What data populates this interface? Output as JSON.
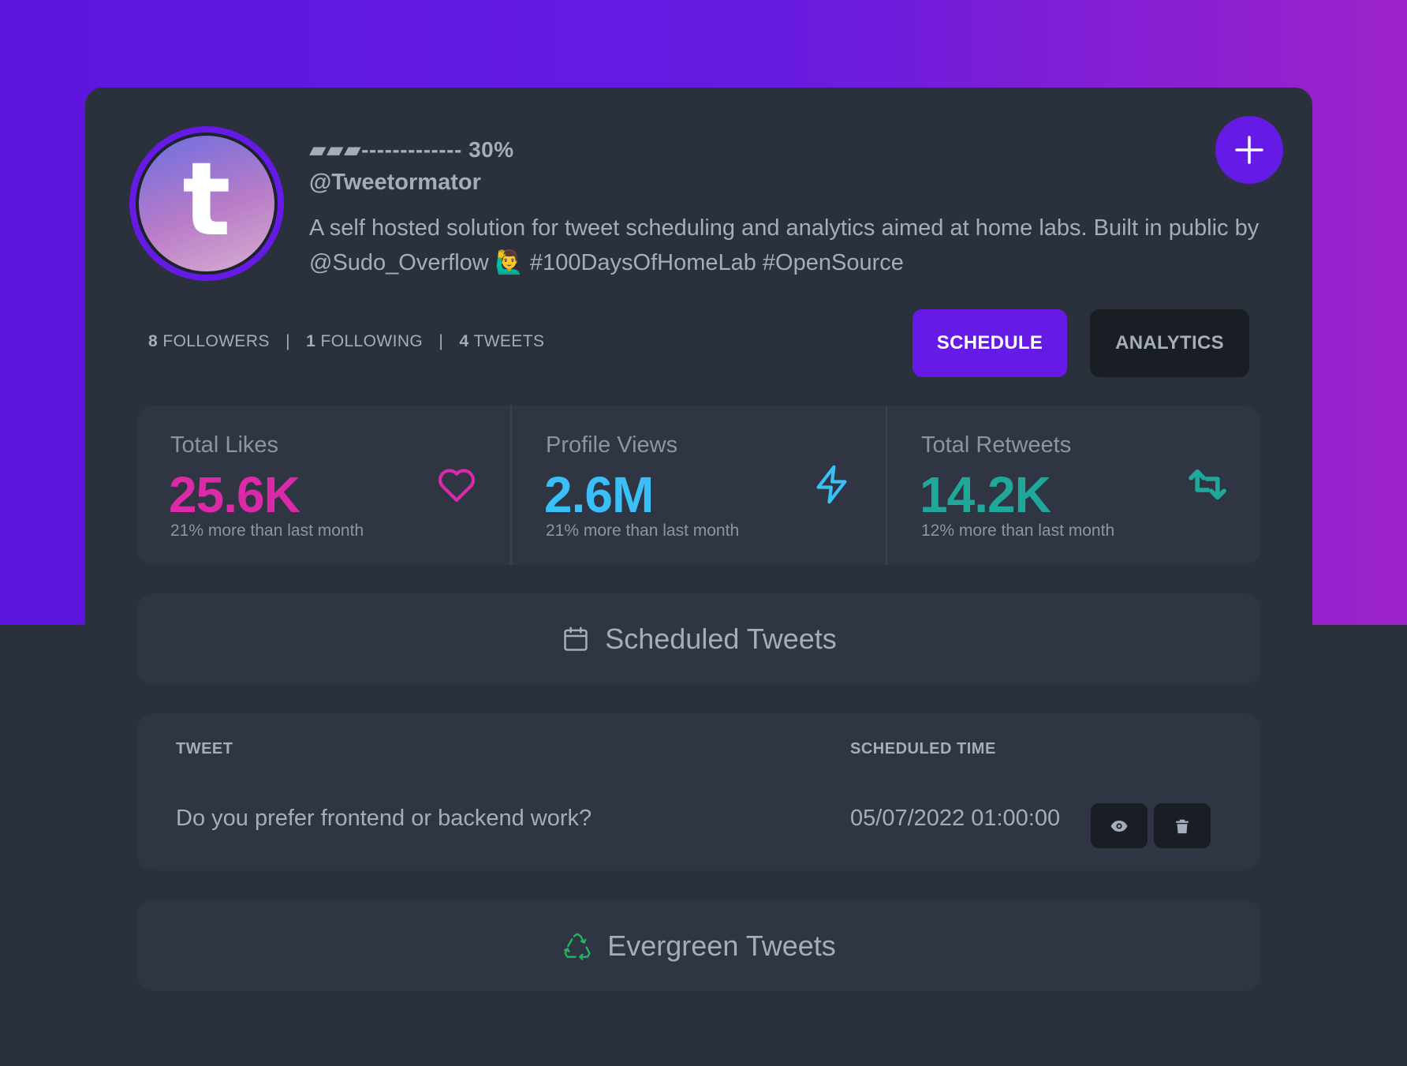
{
  "profile": {
    "avatar_letter": "t",
    "progress_text": "▰▰▰------------- 30%",
    "handle": "@Tweetormator",
    "bio": "A self hosted solution for tweet scheduling and analytics aimed at home labs. Built in public by @Sudo_Overflow 🙋‍♂️ #100DaysOfHomeLab #OpenSource",
    "followers_count": "8",
    "followers_label": "FOLLOWERS",
    "following_count": "1",
    "following_label": "FOLLOWING",
    "tweets_count": "4",
    "tweets_label": "TWEETS",
    "separator": "|"
  },
  "actions": {
    "add_icon": "plus-icon",
    "schedule_label": "SCHEDULE",
    "analytics_label": "ANALYTICS"
  },
  "stats": [
    {
      "title": "Total Likes",
      "value": "25.6K",
      "desc": "21% more than last month",
      "icon": "heart-icon",
      "color": "#db2aa8"
    },
    {
      "title": "Profile Views",
      "value": "2.6M",
      "desc": "21% more than last month",
      "icon": "lightning-icon",
      "color": "#3abff8"
    },
    {
      "title": "Total Retweets",
      "value": "14.2K",
      "desc": "12% more than last month",
      "icon": "retweet-icon",
      "color": "#1fa89a"
    }
  ],
  "scheduled": {
    "title": "Scheduled Tweets",
    "icon": "calendar-icon",
    "headers": {
      "tweet": "TWEET",
      "time": "SCHEDULED TIME"
    },
    "rows": [
      {
        "tweet": "Do you prefer frontend or backend work?",
        "time": "05/07/2022 01:00:00"
      }
    ]
  },
  "evergreen": {
    "title": "Evergreen Tweets",
    "icon": "recycle-icon"
  },
  "colors": {
    "accent": "#661ae6",
    "background": "#2a303c",
    "panel": "#2f3542",
    "text": "#a6adba"
  }
}
